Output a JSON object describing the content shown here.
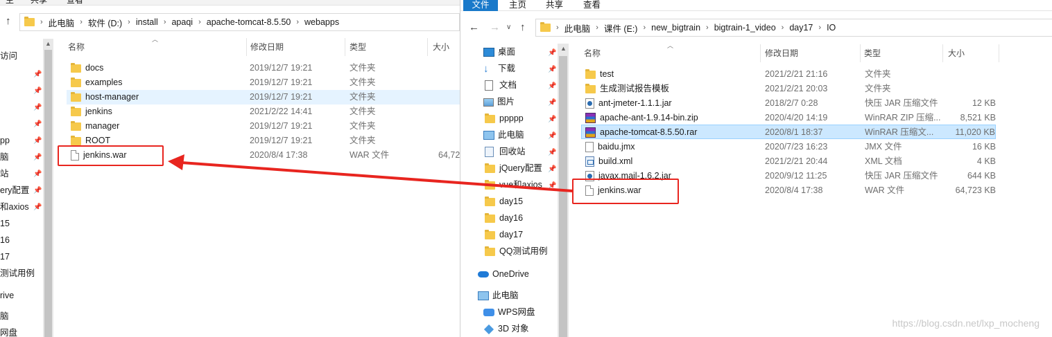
{
  "left_window": {
    "top_partial_labels": [
      "主",
      "共享",
      "查看"
    ],
    "path": [
      "此电脑",
      "软件 (D:)",
      "install",
      "apaqi",
      "apache-tomcat-8.5.50",
      "webapps"
    ],
    "nav_partial": [
      "访问",
      "",
      "",
      "",
      "",
      "pp",
      "脑",
      "站",
      "ery配置",
      "和axios",
      "15",
      "16",
      "17",
      "测试用例",
      "",
      "rive",
      "",
      "脑",
      "网盘"
    ],
    "columns": {
      "name": "名称",
      "modified": "修改日期",
      "type": "类型",
      "size": "大小"
    },
    "files": [
      {
        "name": "docs",
        "date": "2019/12/7 19:21",
        "type": "文件夹",
        "size": "",
        "icon": "folder-icon"
      },
      {
        "name": "examples",
        "date": "2019/12/7 19:21",
        "type": "文件夹",
        "size": "",
        "icon": "folder-icon"
      },
      {
        "name": "host-manager",
        "date": "2019/12/7 19:21",
        "type": "文件夹",
        "size": "",
        "icon": "folder-icon"
      },
      {
        "name": "jenkins",
        "date": "2021/2/22 14:41",
        "type": "文件夹",
        "size": "",
        "icon": "folder-icon"
      },
      {
        "name": "manager",
        "date": "2019/12/7 19:21",
        "type": "文件夹",
        "size": "",
        "icon": "folder-icon"
      },
      {
        "name": "ROOT",
        "date": "2019/12/7 19:21",
        "type": "文件夹",
        "size": "",
        "icon": "folder-icon"
      },
      {
        "name": "jenkins.war",
        "date": "2020/8/4 17:38",
        "type": "WAR 文件",
        "size": "64,72",
        "icon": "file-icon"
      }
    ]
  },
  "right_window": {
    "ribbon_tabs": [
      "文件",
      "主页",
      "共享",
      "查看"
    ],
    "path": [
      "此电脑",
      "课件 (E:)",
      "new_bigtrain",
      "bigtrain-1_video",
      "day17",
      "IO"
    ],
    "nav_items": [
      {
        "label": "桌面",
        "icon": "desktop-icon",
        "pinned": true
      },
      {
        "label": "下载",
        "icon": "download-icon",
        "pinned": true
      },
      {
        "label": "文档",
        "icon": "document-icon",
        "pinned": true
      },
      {
        "label": "图片",
        "icon": "picture-icon",
        "pinned": true
      },
      {
        "label": "ppppp",
        "icon": "folder-icon",
        "pinned": true
      },
      {
        "label": "此电脑",
        "icon": "computer-icon",
        "pinned": true
      },
      {
        "label": "回收站",
        "icon": "recycle-bin-icon",
        "pinned": true
      },
      {
        "label": "jQuery配置",
        "icon": "folder-icon",
        "pinned": true
      },
      {
        "label": "vue和axios",
        "icon": "folder-icon",
        "pinned": true
      },
      {
        "label": "day15",
        "icon": "folder-icon",
        "pinned": false
      },
      {
        "label": "day16",
        "icon": "folder-icon",
        "pinned": false
      },
      {
        "label": "day17",
        "icon": "folder-icon",
        "pinned": false
      },
      {
        "label": "QQ测试用例",
        "icon": "folder-icon",
        "pinned": false
      },
      {
        "label": "OneDrive",
        "icon": "onedrive-icon",
        "pinned": false
      },
      {
        "label": "此电脑",
        "icon": "computer-icon",
        "pinned": false
      },
      {
        "label": "WPS网盘",
        "icon": "wps-cloud-icon",
        "pinned": false
      },
      {
        "label": "3D 对象",
        "icon": "3d-objects-icon",
        "pinned": false
      }
    ],
    "columns": {
      "name": "名称",
      "modified": "修改日期",
      "type": "类型",
      "size": "大小"
    },
    "files": [
      {
        "name": "test",
        "date": "2021/2/21 21:16",
        "type": "文件夹",
        "size": "",
        "icon": "folder-icon"
      },
      {
        "name": "生成测试报告模板",
        "date": "2021/2/21 20:03",
        "type": "文件夹",
        "size": "",
        "icon": "folder-icon"
      },
      {
        "name": "ant-jmeter-1.1.1.jar",
        "date": "2018/2/7 0:28",
        "type": "快压 JAR 压缩文件",
        "size": "12 KB",
        "icon": "jar-icon"
      },
      {
        "name": "apache-ant-1.9.14-bin.zip",
        "date": "2020/4/20 14:19",
        "type": "WinRAR ZIP 压缩...",
        "size": "8,521 KB",
        "icon": "winrar-icon"
      },
      {
        "name": "apache-tomcat-8.5.50.rar",
        "date": "2020/8/1 18:37",
        "type": "WinRAR 压缩文...",
        "size": "11,020 KB",
        "icon": "winrar-icon"
      },
      {
        "name": "baidu.jmx",
        "date": "2020/7/23 16:23",
        "type": "JMX 文件",
        "size": "16 KB",
        "icon": "file-icon"
      },
      {
        "name": "build.xml",
        "date": "2021/2/21 20:44",
        "type": "XML 文档",
        "size": "4 KB",
        "icon": "xml-icon"
      },
      {
        "name": "javax.mail-1.6.2.jar",
        "date": "2020/9/12 11:25",
        "type": "快压 JAR 压缩文件",
        "size": "644 KB",
        "icon": "jar-icon"
      },
      {
        "name": "jenkins.war",
        "date": "2020/8/4 17:38",
        "type": "WAR 文件",
        "size": "64,723 KB",
        "icon": "file-icon"
      }
    ]
  },
  "watermark": "https://blog.csdn.net/lxp_mocheng",
  "colors": {
    "annotation": "#e8251f",
    "selection": "#cce8ff",
    "ribbon_active": "#1979ca"
  }
}
